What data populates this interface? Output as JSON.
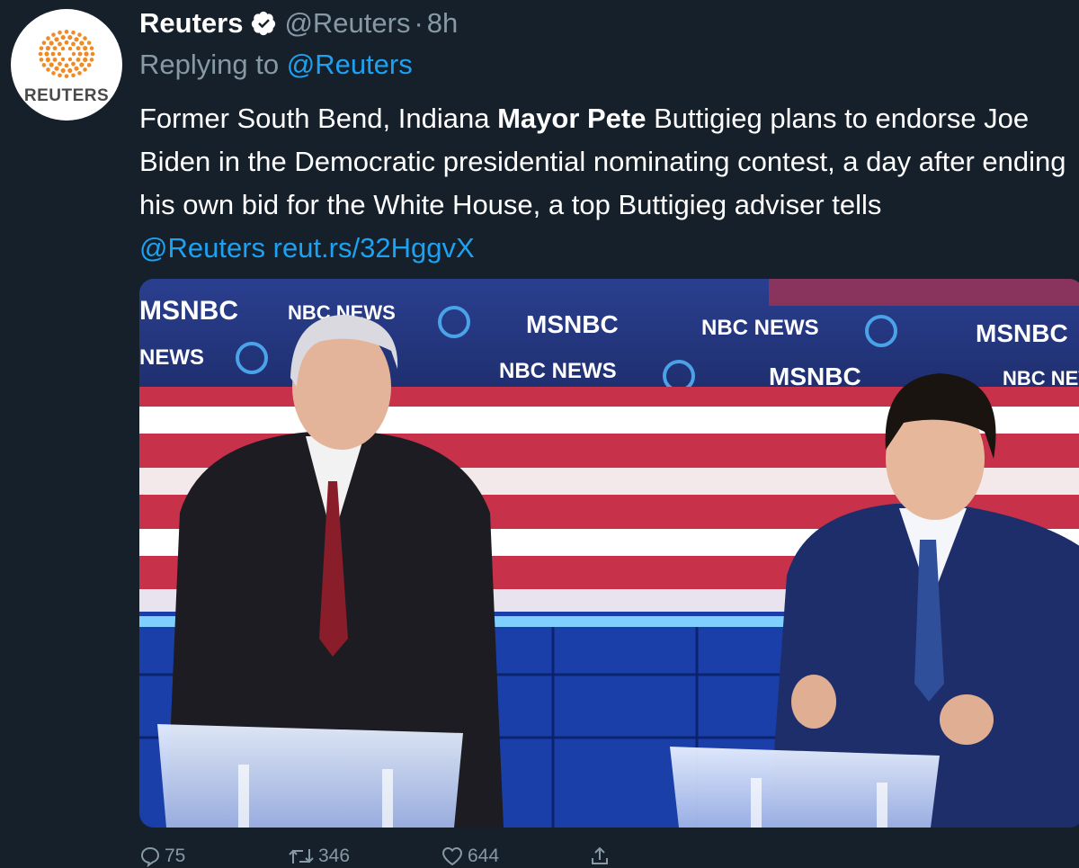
{
  "tweet": {
    "author_name": "Reuters",
    "handle": "@Reuters",
    "separator": "·",
    "time": "8h",
    "avatar_text": "REUTERS",
    "replying_prefix": "Replying to ",
    "replying_to": "@Reuters",
    "text_part1": "Former South Bend, Indiana ",
    "text_bold": "Mayor Pete",
    "text_part2": " Buttigieg plans to endorse Joe Biden in the Democratic presidential nominating contest, a day after ending his own bid for the White House, a top Buttigieg adviser tells ",
    "text_mention": "@Reuters",
    "text_space": " ",
    "text_link": "reut.rs/32HggvX"
  },
  "media": {
    "description_icons": [
      "msnbc-logo",
      "nbc-news-logo",
      "democrats-logo"
    ],
    "backdrop_labels": [
      "MSNBC",
      "NBC NEWS",
      "MSNBC",
      "NBC NEWS"
    ]
  },
  "actions": {
    "reply_count": "75",
    "retweet_count": "346",
    "like_count": "644"
  },
  "colors": {
    "background": "#15202b",
    "text": "#ffffff",
    "secondary": "#8899a6",
    "link": "#1da1f2",
    "reuters_orange": "#f08a24"
  }
}
